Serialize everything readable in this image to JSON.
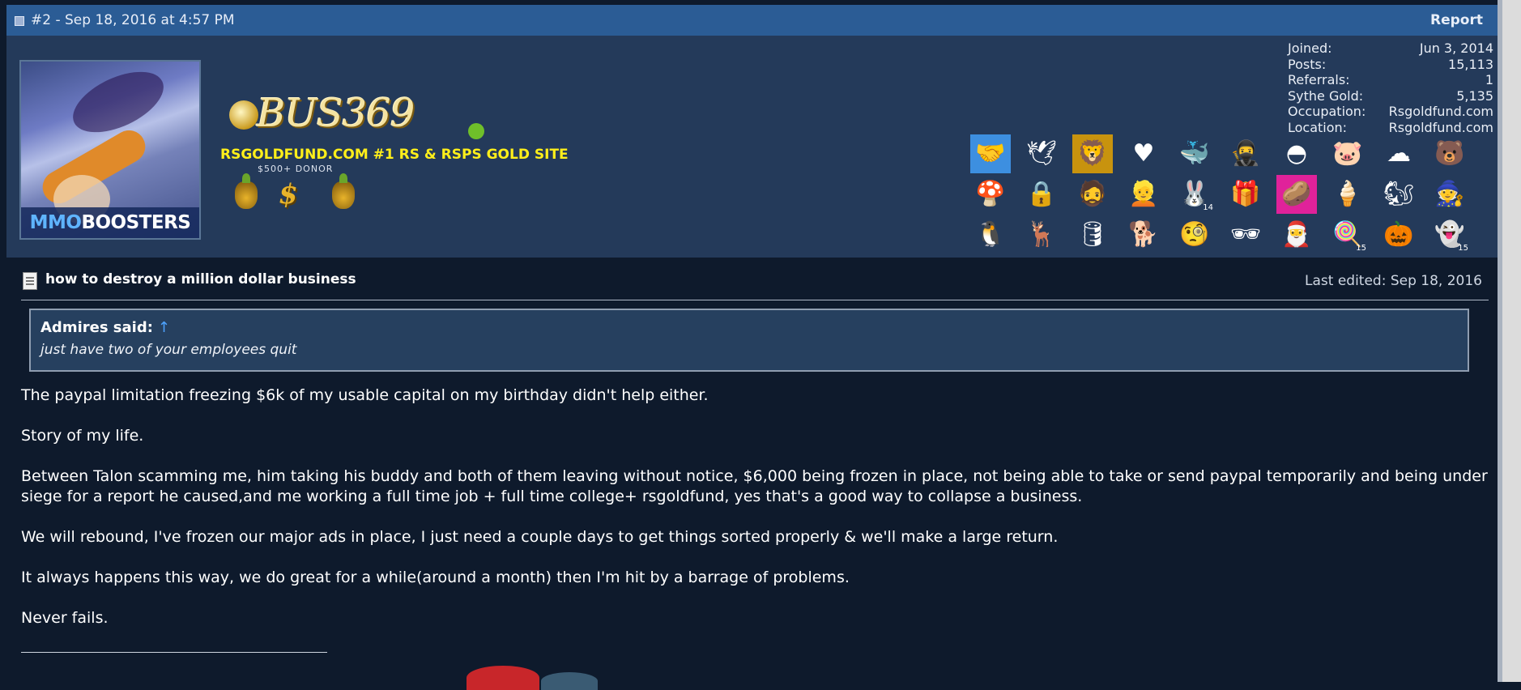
{
  "post": {
    "header": "#2 - Sep 18, 2016 at 4:57 PM",
    "report_label": "Report"
  },
  "user": {
    "avatar_text_a": "MMO",
    "avatar_text_b": "BOOSTERS",
    "logo_text": "BUS369",
    "tagline": "RSGOLDFUND.COM #1 RS & RSPS GOLD SITE",
    "rank_label": "$500+ DONOR",
    "stats": [
      {
        "label": "Joined:",
        "value": "Jun 3, 2014"
      },
      {
        "label": "Posts:",
        "value": "15,113"
      },
      {
        "label": "Referrals:",
        "value": "1"
      },
      {
        "label": "Sythe Gold:",
        "value": "5,135"
      },
      {
        "label": "Occupation:",
        "value": "Rsgoldfund.com"
      },
      {
        "label": "Location:",
        "value": "Rsgoldfund.com"
      }
    ],
    "badges": [
      {
        "icon": "handshake-icon",
        "glyph": "🤝",
        "bg": "#3d8fe0"
      },
      {
        "icon": "bird-icon",
        "glyph": "🕊",
        "bg": "transparent"
      },
      {
        "icon": "lion-icon",
        "glyph": "🦁",
        "bg": "#c8930e"
      },
      {
        "icon": "heart-n4n0-icon",
        "glyph": "♥",
        "bg": "transparent"
      },
      {
        "icon": "whale-icon",
        "glyph": "🐳",
        "bg": "transparent"
      },
      {
        "icon": "ninja-icon",
        "glyph": "🥷",
        "bg": "transparent"
      },
      {
        "icon": "pokeball-icon",
        "glyph": "◓",
        "bg": "transparent"
      },
      {
        "icon": "pig-icon",
        "glyph": "🐷",
        "bg": "transparent"
      },
      {
        "icon": "lumpy-space-icon",
        "glyph": "☁",
        "bg": "transparent"
      },
      {
        "icon": "rainbow-bear-icon",
        "glyph": "🐻",
        "bg": "transparent"
      },
      {
        "icon": "mushroom-icon",
        "glyph": "🍄",
        "bg": "transparent"
      },
      {
        "icon": "padlock-icon",
        "glyph": "🔒",
        "bg": "transparent"
      },
      {
        "icon": "comic-guy-icon",
        "glyph": "🧔",
        "bg": "transparent"
      },
      {
        "icon": "blonde-face-icon",
        "glyph": "👱",
        "bg": "transparent"
      },
      {
        "icon": "bunny-icon",
        "glyph": "🐰",
        "bg": "transparent",
        "count": "14"
      },
      {
        "icon": "gift-icon",
        "glyph": "🎁",
        "bg": "transparent"
      },
      {
        "icon": "potato-icon",
        "glyph": "🥔",
        "bg": "#e0229a"
      },
      {
        "icon": "ice-cream-icon",
        "glyph": "🍦",
        "bg": "transparent"
      },
      {
        "icon": "squirrel-icon",
        "glyph": "🐿",
        "bg": "transparent"
      },
      {
        "icon": "gnome-icon",
        "glyph": "🧙",
        "bg": "transparent"
      },
      {
        "icon": "penguin-icon",
        "glyph": "🐧",
        "bg": "transparent"
      },
      {
        "icon": "reindeer-icon",
        "glyph": "🦌",
        "bg": "transparent"
      },
      {
        "icon": "barrel-icon",
        "glyph": "🛢",
        "bg": "transparent"
      },
      {
        "icon": "doge-icon",
        "glyph": "🐕",
        "bg": "transparent"
      },
      {
        "icon": "monocle-face-icon",
        "glyph": "🧐",
        "bg": "transparent"
      },
      {
        "icon": "heisenberg-icon",
        "glyph": "🕶",
        "bg": "transparent"
      },
      {
        "icon": "santa-icon",
        "glyph": "🎅",
        "bg": "transparent"
      },
      {
        "icon": "candy-cane-icon",
        "glyph": "🍭",
        "bg": "transparent",
        "count": "15"
      },
      {
        "icon": "pumpkin-icon",
        "glyph": "🎃",
        "bg": "transparent"
      },
      {
        "icon": "ghost-icon",
        "glyph": "👻",
        "bg": "transparent",
        "count": "15"
      }
    ]
  },
  "content": {
    "title": "how to destroy a million dollar business",
    "last_edited": "Last edited: Sep 18, 2016",
    "quote_author": "Admires said:",
    "quote_arrow": "↑",
    "quote_text": "just have two of your employees quit",
    "paragraphs": [
      "The paypal limitation freezing $6k of my usable capital on my birthday didn't help either.",
      "Story of my life.",
      "Between Talon scamming me, him taking his buddy and both of them leaving without notice, $6,000 being frozen in place, not being able to take or send paypal temporarily and being under siege for a report he caused,and me working a full time job + full time college+ rsgoldfund, yes that's a good way to collapse a business.",
      "We will rebound, I've frozen our major ads in place, I just need a couple days to get things sorted properly & we'll make a large return.",
      "It always happens this way, we do great for a while(around a month) then I'm hit by a barrage of problems.",
      "Never fails."
    ]
  }
}
